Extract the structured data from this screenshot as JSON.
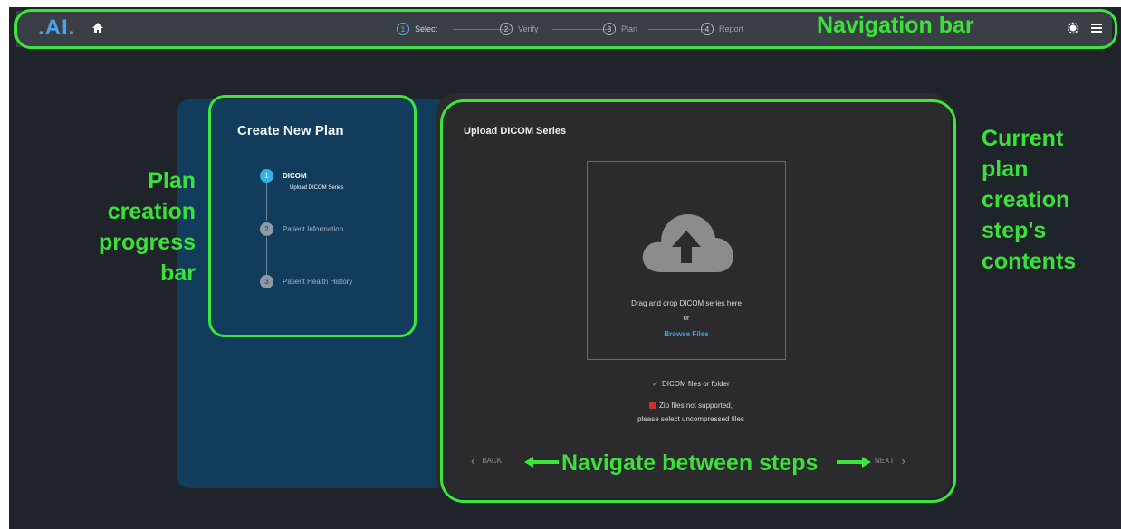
{
  "nav": {
    "logo": ".AI.",
    "steps": [
      {
        "num": "1",
        "label": "Select",
        "active": true
      },
      {
        "num": "2",
        "label": "Verify",
        "active": false
      },
      {
        "num": "3",
        "label": "Plan",
        "active": false
      },
      {
        "num": "4",
        "label": "Report",
        "active": false
      }
    ]
  },
  "annotations": {
    "navbar": "Navigation bar",
    "progress_bar": [
      "Plan",
      "creation",
      "progress",
      "bar"
    ],
    "current_step": [
      "Current",
      "plan",
      "creation",
      "step's",
      "contents"
    ],
    "navigate": "Navigate between steps"
  },
  "progress": {
    "title": "Create New Plan",
    "items": [
      {
        "num": "1",
        "label": "DICOM",
        "active": true
      },
      {
        "num": "2",
        "label": "Patient Information",
        "active": false
      },
      {
        "num": "3",
        "label": "Patient Health History",
        "active": false
      }
    ],
    "sub_label": "Upload DICOM Series"
  },
  "content": {
    "title": "Upload DICOM Series",
    "drop_text": "Drag and drop DICOM series here",
    "or": "or",
    "browse": "Browse Files",
    "check1": "DICOM files or folder",
    "check2_line1": "Zip files not supported,",
    "check2_line2": "please select uncompressed files",
    "back": "BACK",
    "next": "NEXT"
  },
  "colors": {
    "annotation": "#39e639",
    "accent": "#35b0e8",
    "panel_blue": "#123c5c"
  }
}
